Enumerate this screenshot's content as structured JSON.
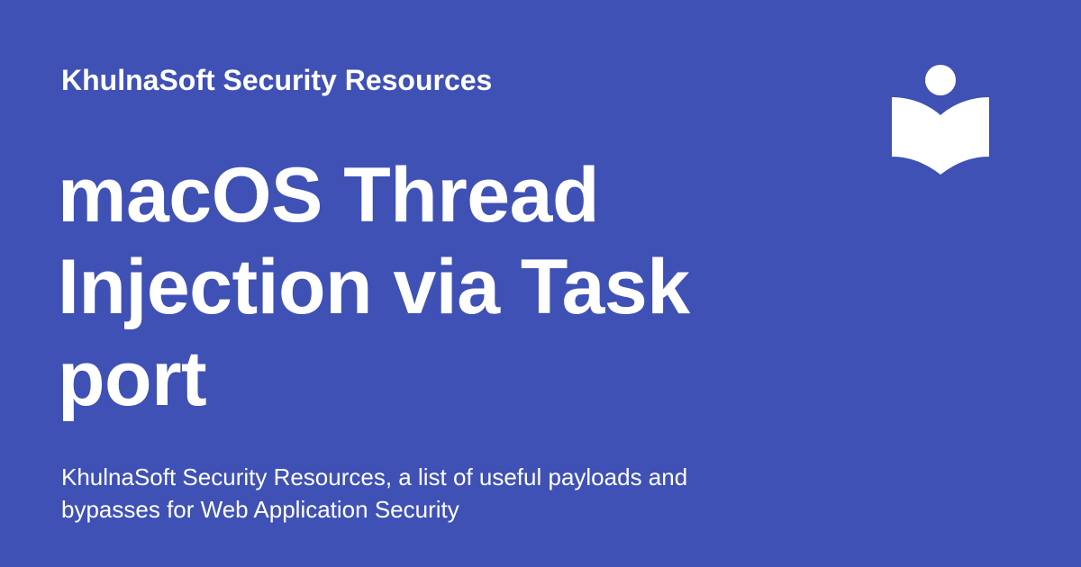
{
  "colors": {
    "background": "#3f51b5",
    "text": "#ffffff",
    "logo": "#ffffff"
  },
  "site": {
    "name": "KhulnaSoft Security Resources"
  },
  "page": {
    "title": "macOS Thread Injection via Task port",
    "description": "KhulnaSoft Security Resources, a list of useful payloads and bypasses for Web Application Security"
  },
  "logo": {
    "icon": "book-reader-icon"
  }
}
